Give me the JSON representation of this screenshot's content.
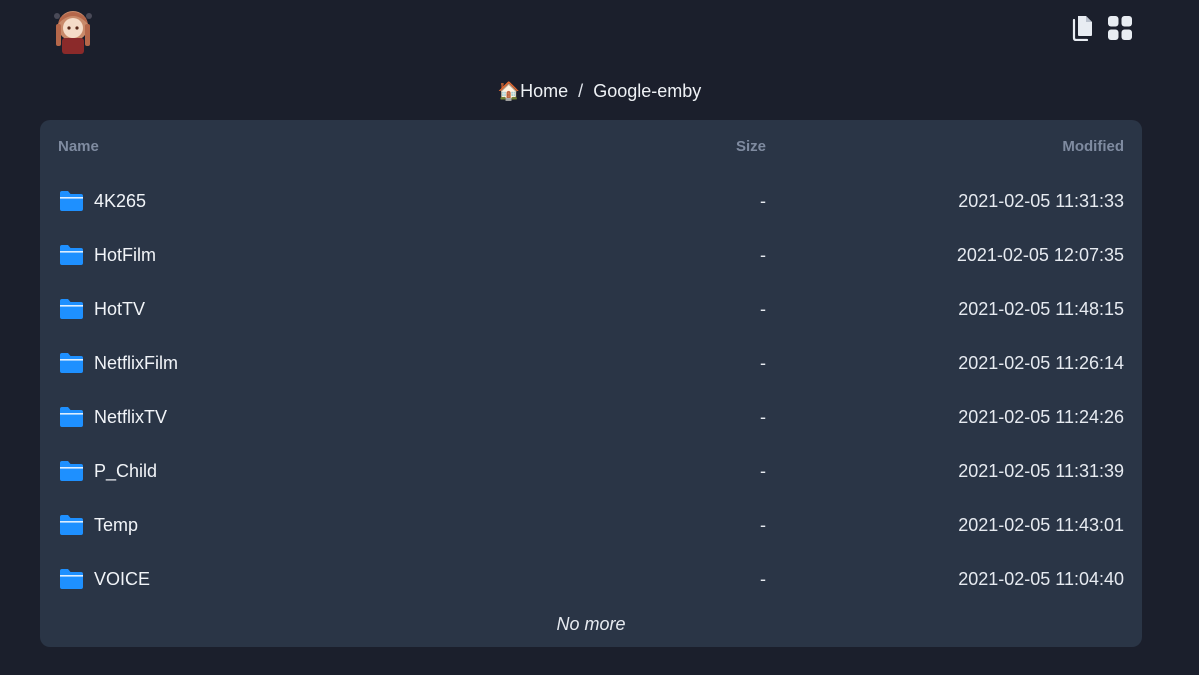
{
  "header": {
    "avatar_icon": "anime-avatar-icon",
    "actions": [
      {
        "icon": "copy-icon"
      },
      {
        "icon": "grid-view-icon"
      }
    ]
  },
  "breadcrumb": {
    "home_glyph": "🏠",
    "items": [
      "Home",
      "Google-emby"
    ],
    "separator": "/"
  },
  "table": {
    "columns": {
      "name": "Name",
      "size": "Size",
      "modified": "Modified"
    },
    "rows": [
      {
        "name": "4K265",
        "size": "-",
        "modified": "2021-02-05 11:31:33"
      },
      {
        "name": "HotFilm",
        "size": "-",
        "modified": "2021-02-05 12:07:35"
      },
      {
        "name": "HotTV",
        "size": "-",
        "modified": "2021-02-05 11:48:15"
      },
      {
        "name": "NetflixFilm",
        "size": "-",
        "modified": "2021-02-05 11:26:14"
      },
      {
        "name": "NetflixTV",
        "size": "-",
        "modified": "2021-02-05 11:24:26"
      },
      {
        "name": "P_Child",
        "size": "-",
        "modified": "2021-02-05 11:31:39"
      },
      {
        "name": "Temp",
        "size": "-",
        "modified": "2021-02-05 11:43:01"
      },
      {
        "name": "VOICE",
        "size": "-",
        "modified": "2021-02-05 11:04:40"
      }
    ],
    "footer": "No more"
  },
  "colors": {
    "background": "#1b1f2c",
    "panel": "#2a3546",
    "folder": "#1e90ff",
    "header_text": "#7f8ba0"
  }
}
